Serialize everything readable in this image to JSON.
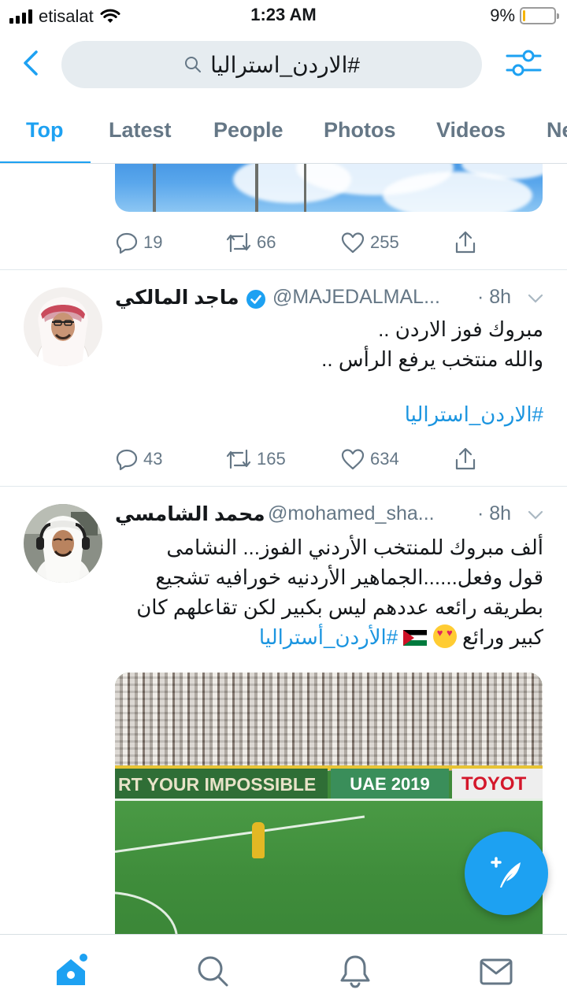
{
  "status_bar": {
    "carrier": "etisalat",
    "time": "1:23 AM",
    "battery_percent_text": "9%",
    "battery_level": 0.09
  },
  "header": {
    "search_query": "#الاردن_استراليا",
    "back_icon": "chevron-left-icon",
    "filter_icon": "sliders-icon"
  },
  "tabs": [
    {
      "label": "Top",
      "active": true
    },
    {
      "label": "Latest",
      "active": false
    },
    {
      "label": "People",
      "active": false
    },
    {
      "label": "Photos",
      "active": false
    },
    {
      "label": "Videos",
      "active": false
    },
    {
      "label": "Ne",
      "active": false
    }
  ],
  "prev_tweet": {
    "replies": "19",
    "retweets": "66",
    "likes": "255"
  },
  "tweets": [
    {
      "name": "ماجد المالكي",
      "verified": true,
      "handle": "@MAJEDALMAL...",
      "time": "· 8h",
      "text_lines": [
        "مبروك فوز الاردن ..",
        "والله منتخب يرفع الرأس .."
      ],
      "hashtag": "#الاردن_استراليا",
      "replies": "43",
      "retweets": "165",
      "likes": "634"
    },
    {
      "name": "محمد الشامسي",
      "verified": false,
      "handle": "@mohamed_sha...",
      "time": "· 8h",
      "text_lines": [
        "ألف مبروك للمنتخب الأردني الفوز... النشامى",
        "قول وفعل......الجماهير الأردنيه خورافيه تشجيع",
        "بطريقه رائعه عددهم ليس بكبير لكن تقاعلهم كان",
        "كبير ورائع"
      ],
      "hashtag": "#الأردن_أستراليا",
      "video_ads": [
        "RT YOUR IMPOSSIBLE",
        "UAE 2019",
        "TOYOT"
      ]
    }
  ],
  "bottom_nav": [
    "home-icon",
    "search-icon",
    "notifications-icon",
    "messages-icon"
  ],
  "colors": {
    "accent": "#1da1f2",
    "hashtag": "#1b95e0",
    "secondary_text": "#657786"
  }
}
